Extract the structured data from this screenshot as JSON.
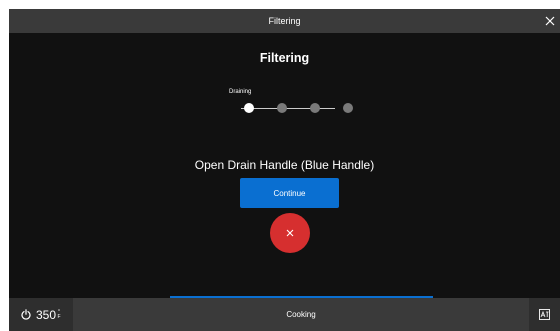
{
  "titlebar": {
    "title": "Filtering"
  },
  "main": {
    "title": "Filtering",
    "steps": {
      "current_label": "Draining",
      "total": 4,
      "active_index": 0
    },
    "instruction": "Open Drain Handle (Blue Handle)",
    "continue_label": "Continue"
  },
  "bottom": {
    "temperature": "350",
    "unit_top": "°",
    "unit_bottom": "F",
    "mode": "Cooking"
  },
  "colors": {
    "accent": "#0a6fd1",
    "cancel": "#d62f2f"
  },
  "icons": {
    "close": "close-icon",
    "power": "power-icon",
    "cancel": "x-icon",
    "language": "language-icon"
  }
}
